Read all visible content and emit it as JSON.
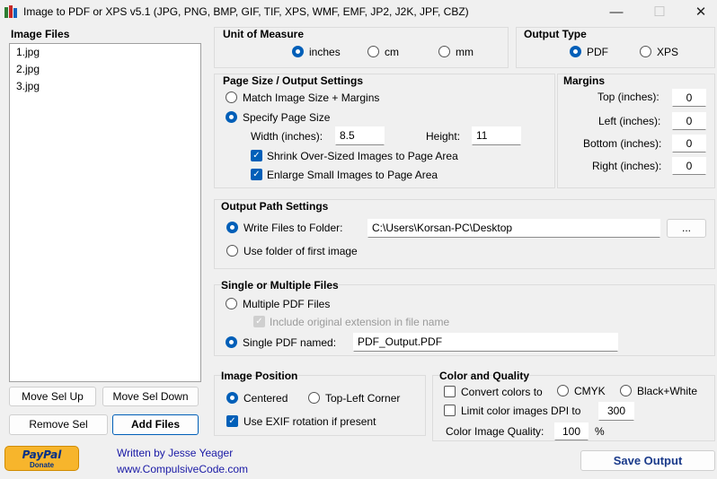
{
  "window": {
    "title": "Image to PDF or XPS  v5.1  (JPG, PNG, BMP, GIF, TIF, XPS, WMF, EMF, JP2, J2K, JPF, CBZ)",
    "minimize": "—",
    "maximize": "☐",
    "close": "✕"
  },
  "image_files": {
    "title": "Image Files",
    "items": [
      "1.jpg",
      "2.jpg",
      "3.jpg"
    ],
    "move_up": "Move Sel Up",
    "move_down": "Move Sel Down",
    "remove": "Remove Sel",
    "add": "Add Files"
  },
  "unit": {
    "title": "Unit of Measure",
    "options": [
      "inches",
      "cm",
      "mm"
    ],
    "selected": "inches"
  },
  "output_type": {
    "title": "Output Type",
    "options": [
      "PDF",
      "XPS"
    ],
    "selected": "PDF"
  },
  "page_size": {
    "title": "Page Size / Output Settings",
    "match": "Match Image Size + Margins",
    "specify": "Specify Page Size",
    "width_label": "Width (inches):",
    "width": "8.5",
    "height_label": "Height:",
    "height": "11",
    "shrink": "Shrink Over-Sized Images to Page Area",
    "enlarge": "Enlarge Small Images to Page Area"
  },
  "margins": {
    "title": "Margins",
    "top_label": "Top (inches):",
    "top": "0",
    "left_label": "Left (inches):",
    "left": "0",
    "bottom_label": "Bottom (inches):",
    "bottom": "0",
    "right_label": "Right (inches):",
    "right": "0"
  },
  "output_path": {
    "title": "Output Path Settings",
    "write_label": "Write Files to Folder:",
    "folder": "C:\\Users\\Korsan-PC\\Desktop",
    "browse": "...",
    "first_image": "Use folder of first image"
  },
  "single_multi": {
    "title": "Single or Multiple Files",
    "multiple": "Multiple PDF Files",
    "include_ext": "Include original extension in file name",
    "single_label": "Single PDF named:",
    "single_name": "PDF_Output.PDF"
  },
  "image_position": {
    "title": "Image Position",
    "centered": "Centered",
    "top_left": "Top-Left Corner",
    "exif": "Use EXIF rotation if present"
  },
  "color_quality": {
    "title": "Color and Quality",
    "convert": "Convert colors to",
    "cmyk": "CMYK",
    "bw": "Black+White",
    "limit_dpi": "Limit color images DPI to",
    "dpi": "300",
    "quality_label": "Color Image Quality:",
    "quality": "100",
    "percent": "%"
  },
  "footer": {
    "paypal": "PayPal",
    "donate": "Donate",
    "written_by": "Written by Jesse Yeager",
    "website": "www.CompulsiveCode.com",
    "save": "Save Output"
  },
  "colors": {
    "accent": "#005fb8",
    "link": "#1a1aa6",
    "paypal_gold": "#f7b52c"
  }
}
